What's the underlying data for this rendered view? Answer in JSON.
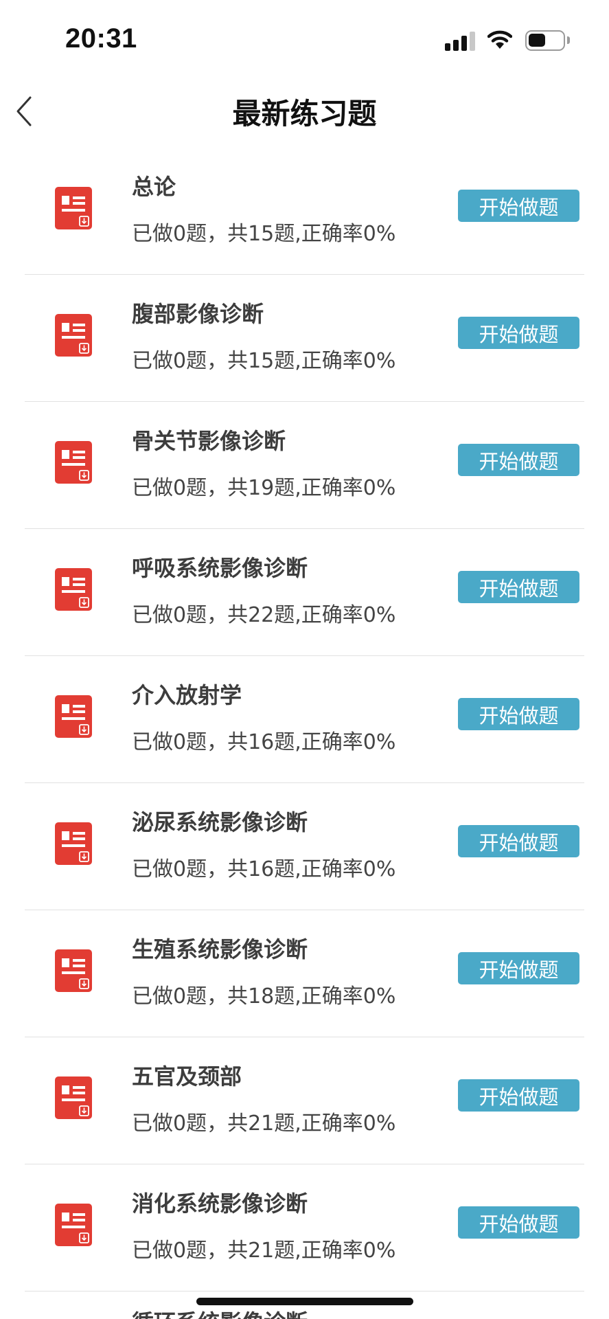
{
  "status_bar": {
    "time": "20:31",
    "signal_bars_filled": 3,
    "signal_bars_total": 4,
    "battery_level": 0.5
  },
  "nav": {
    "title": "最新练习题",
    "back_icon": "chevron-left-icon"
  },
  "colors": {
    "button_bg": "#4aa9c8",
    "icon_red": "#e23c33"
  },
  "exercises": [
    {
      "title": "总论",
      "progress": "已做0题，共15题,正确率0%",
      "button": "开始做题"
    },
    {
      "title": "腹部影像诊断",
      "progress": "已做0题，共15题,正确率0%",
      "button": "开始做题"
    },
    {
      "title": "骨关节影像诊断",
      "progress": "已做0题，共19题,正确率0%",
      "button": "开始做题"
    },
    {
      "title": "呼吸系统影像诊断",
      "progress": "已做0题，共22题,正确率0%",
      "button": "开始做题"
    },
    {
      "title": "介入放射学",
      "progress": "已做0题，共16题,正确率0%",
      "button": "开始做题"
    },
    {
      "title": "泌尿系统影像诊断",
      "progress": "已做0题，共16题,正确率0%",
      "button": "开始做题"
    },
    {
      "title": "生殖系统影像诊断",
      "progress": "已做0题，共18题,正确率0%",
      "button": "开始做题"
    },
    {
      "title": "五官及颈部",
      "progress": "已做0题，共21题,正确率0%",
      "button": "开始做题"
    },
    {
      "title": "消化系统影像诊断",
      "progress": "已做0题，共21题,正确率0%",
      "button": "开始做题"
    }
  ],
  "partial_next_item_title": "循环系统影像诊断"
}
